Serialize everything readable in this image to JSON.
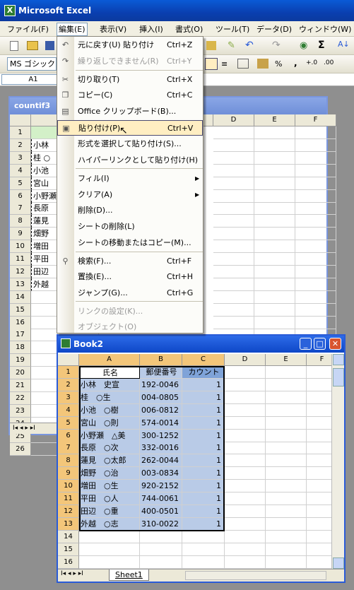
{
  "app": {
    "title": "Microsoft Excel"
  },
  "menubar": [
    "ファイル(F)",
    "編集(E)",
    "表示(V)",
    "挿入(I)",
    "書式(O)",
    "ツール(T)",
    "データ(D)",
    "ウィンドウ(W)"
  ],
  "toolbar": {
    "font_name": "MS ゴシック",
    "percent": "%",
    "comma": ","
  },
  "namebox": "A1",
  "back_window": {
    "title": "countif3",
    "rows": [
      "1",
      "2",
      "3",
      "4",
      "5",
      "6",
      "7",
      "8",
      "9",
      "10",
      "11",
      "12",
      "13",
      "14",
      "15",
      "16",
      "17",
      "18",
      "19",
      "20",
      "21",
      "22",
      "23",
      "24",
      "25",
      "26"
    ],
    "names": [
      "",
      "小林",
      "桂 ○",
      "小池",
      "宮山",
      "小野瀬",
      "長原",
      "蓮見",
      "畑野",
      "増田",
      "平田",
      "田辺",
      "外越"
    ],
    "cols": [
      "D",
      "E",
      "F"
    ]
  },
  "edit_menu": {
    "items": [
      {
        "label": "元に戻す(U) 貼り付け",
        "shortcut": "Ctrl+Z",
        "icon": "undo-icon",
        "disabled": false
      },
      {
        "label": "繰り返しできません(R)",
        "shortcut": "Ctrl+Y",
        "icon": "redo-icon",
        "disabled": true
      },
      {
        "label": "切り取り(T)",
        "shortcut": "Ctrl+X",
        "icon": "cut-icon",
        "disabled": false
      },
      {
        "label": "コピー(C)",
        "shortcut": "Ctrl+C",
        "icon": "copy-icon",
        "disabled": false
      },
      {
        "label": "Office クリップボード(B)...",
        "shortcut": "",
        "icon": "clipboard-icon",
        "disabled": false
      },
      {
        "label": "貼り付け(P)",
        "shortcut": "Ctrl+V",
        "icon": "paste-icon",
        "disabled": false,
        "highlighted": true
      },
      {
        "label": "形式を選択して貼り付け(S)...",
        "shortcut": "",
        "disabled": false
      },
      {
        "label": "ハイパーリンクとして貼り付け(H)",
        "shortcut": "",
        "disabled": false
      },
      {
        "label": "フィル(I)",
        "shortcut": "",
        "submenu": true,
        "disabled": false
      },
      {
        "label": "クリア(A)",
        "shortcut": "",
        "submenu": true,
        "disabled": false
      },
      {
        "label": "削除(D)...",
        "shortcut": "",
        "disabled": false
      },
      {
        "label": "シートの削除(L)",
        "shortcut": "",
        "disabled": false
      },
      {
        "label": "シートの移動またはコピー(M)...",
        "shortcut": "",
        "disabled": false
      },
      {
        "label": "検索(F)...",
        "shortcut": "Ctrl+F",
        "icon": "find-icon",
        "disabled": false
      },
      {
        "label": "置換(E)...",
        "shortcut": "Ctrl+H",
        "disabled": false
      },
      {
        "label": "ジャンプ(G)...",
        "shortcut": "Ctrl+G",
        "disabled": false
      },
      {
        "label": "リンクの設定(K)...",
        "shortcut": "",
        "disabled": true
      },
      {
        "label": "オブジェクト(O)",
        "shortcut": "",
        "disabled": true
      }
    ]
  },
  "book2": {
    "title": "Book2",
    "columns": [
      "A",
      "B",
      "C",
      "D",
      "E",
      "F"
    ],
    "headers": [
      "氏名",
      "郵便番号",
      "カウント"
    ],
    "rows": [
      [
        "小林　史宣",
        "192-0046",
        "1"
      ],
      [
        "桂　○生",
        "004-0805",
        "1"
      ],
      [
        "小池　○樹",
        "006-0812",
        "1"
      ],
      [
        "宮山　○則",
        "574-0014",
        "1"
      ],
      [
        "小野瀬　△美",
        "300-1252",
        "1"
      ],
      [
        "長原　○次",
        "332-0016",
        "1"
      ],
      [
        "蓮見　○太郎",
        "262-0044",
        "1"
      ],
      [
        "畑野　○治",
        "003-0834",
        "1"
      ],
      [
        "増田　○生",
        "920-2152",
        "1"
      ],
      [
        "平田　○人",
        "744-0061",
        "1"
      ],
      [
        "田辺　○重",
        "400-0501",
        "1"
      ],
      [
        "外越　○志",
        "310-0022",
        "1"
      ]
    ],
    "row_numbers": [
      "1",
      "2",
      "3",
      "4",
      "5",
      "6",
      "7",
      "8",
      "9",
      "10",
      "11",
      "12",
      "13",
      "14",
      "15",
      "16"
    ],
    "sheet_tab": "Sheet1"
  }
}
